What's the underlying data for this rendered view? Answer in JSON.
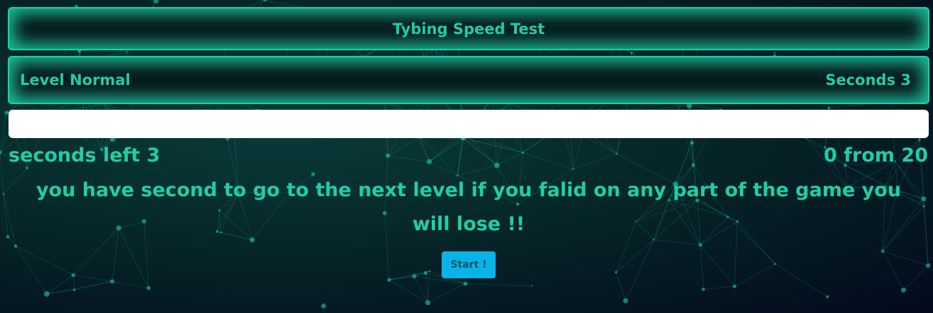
{
  "header": {
    "title": "Tybing Speed Test"
  },
  "info": {
    "level": "Level Normal",
    "seconds": "Seconds 3"
  },
  "input": {
    "value": "",
    "placeholder": ""
  },
  "status": {
    "seconds_left": "seconds left 3",
    "score": "0 from 20"
  },
  "message": "you have second to go to the next level if you falid on any part of the game you will lose !!",
  "start_button": "Start !",
  "colors": {
    "accent": "#1ecfa6",
    "button": "#08b3e8",
    "background": "#03141c"
  }
}
